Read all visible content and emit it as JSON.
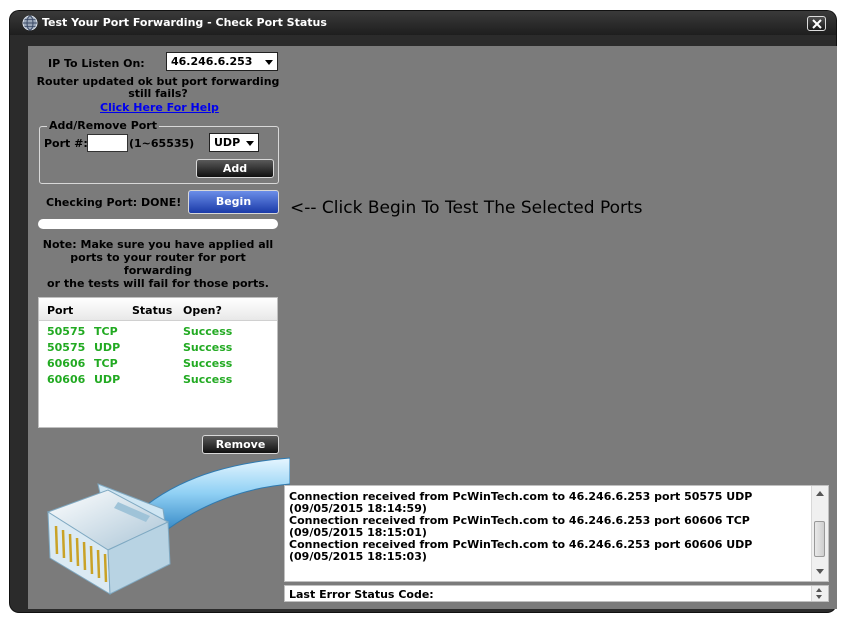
{
  "window": {
    "title": "Test Your Port Forwarding - Check Port Status",
    "close_label": "X"
  },
  "listen": {
    "label": "IP To Listen On:",
    "selected_ip": "46.246.6.253"
  },
  "help": {
    "line1": "Router updated ok but port forwarding",
    "line2": "still fails?",
    "link": "Click Here For Help"
  },
  "add_remove": {
    "group_title": "Add/Remove Port",
    "port_label": "Port #:",
    "port_value": "",
    "range_text": "(1~65535)",
    "protocol_selected": "UDP",
    "add_label": "Add"
  },
  "check": {
    "status_label": "Checking Port: DONE!",
    "begin_label": "Begin",
    "hint": "<-- Click Begin To Test The Selected Ports",
    "progress": 0
  },
  "note": {
    "line1": "Note: Make sure you have applied all",
    "line2": "ports to your router for port forwarding",
    "line3": "or the tests will fail for those ports."
  },
  "ports_table": {
    "columns": [
      "Port",
      "Status",
      "Open?"
    ],
    "rows": [
      {
        "port": "50575",
        "protocol": "TCP",
        "status": "",
        "open": "Success"
      },
      {
        "port": "50575",
        "protocol": "UDP",
        "status": "",
        "open": "Success"
      },
      {
        "port": "60606",
        "protocol": "TCP",
        "status": "",
        "open": "Success"
      },
      {
        "port": "60606",
        "protocol": "UDP",
        "status": "",
        "open": "Success"
      }
    ],
    "remove_label": "Remove"
  },
  "log": {
    "lines": [
      "Connection received from PcWinTech.com to 46.246.6.253 port 50575 UDP",
      "(09/05/2015 18:14:59)",
      "Connection received from PcWinTech.com to 46.246.6.253 port 60606 TCP",
      "(09/05/2015 18:15:01)",
      "Connection received from PcWinTech.com to 46.246.6.253 port 60606 UDP",
      "(09/05/2015 18:15:03)"
    ]
  },
  "error_status": {
    "label": "Last Error Status Code:"
  },
  "icons": {
    "title": "globe-icon",
    "illustration": "ethernet-cable-icon"
  },
  "colors": {
    "success": "#22aa22",
    "link": "#0000ee",
    "begin_button": "#2a4cc0",
    "panel": "#7b7b7b"
  }
}
